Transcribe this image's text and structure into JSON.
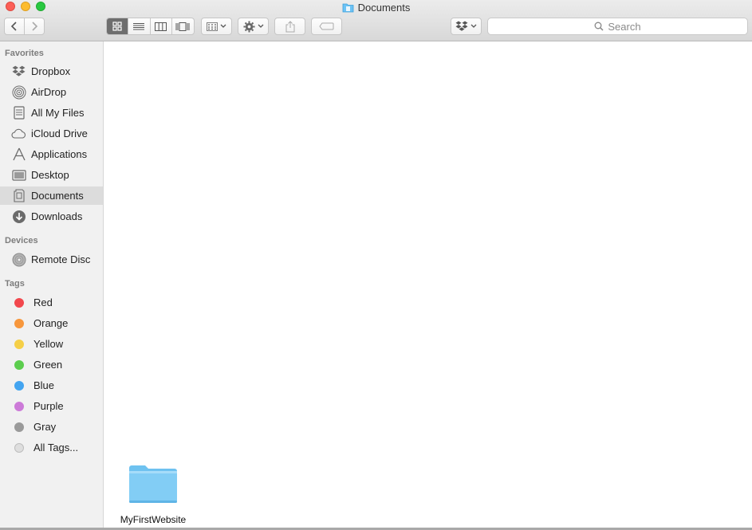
{
  "window": {
    "title": "Documents"
  },
  "toolbar": {
    "back": "chevron-left-icon",
    "forward": "chevron-right-icon",
    "views": [
      "icon-view",
      "list-view",
      "column-view",
      "cover-flow-view"
    ],
    "active_view": "icon-view",
    "search_placeholder": "Search"
  },
  "sidebar": {
    "favorites_label": "Favorites",
    "favorites": [
      {
        "label": "Dropbox",
        "icon": "dropbox-icon"
      },
      {
        "label": "AirDrop",
        "icon": "airdrop-icon"
      },
      {
        "label": "All My Files",
        "icon": "all-files-icon"
      },
      {
        "label": "iCloud Drive",
        "icon": "cloud-icon"
      },
      {
        "label": "Applications",
        "icon": "applications-icon"
      },
      {
        "label": "Desktop",
        "icon": "desktop-icon"
      },
      {
        "label": "Documents",
        "icon": "documents-icon",
        "selected": true
      },
      {
        "label": "Downloads",
        "icon": "downloads-icon"
      }
    ],
    "devices_label": "Devices",
    "devices": [
      {
        "label": "Remote Disc",
        "icon": "disc-icon"
      }
    ],
    "tags_label": "Tags",
    "tags": [
      {
        "label": "Red",
        "color": "#f2484d"
      },
      {
        "label": "Orange",
        "color": "#f7973c"
      },
      {
        "label": "Yellow",
        "color": "#f5cf47"
      },
      {
        "label": "Green",
        "color": "#5ccd4e"
      },
      {
        "label": "Blue",
        "color": "#43a4f0"
      },
      {
        "label": "Purple",
        "color": "#cc7ad8"
      },
      {
        "label": "Gray",
        "color": "#9a9a9a"
      },
      {
        "label": "All Tags...",
        "color": "#dedede"
      }
    ]
  },
  "content": {
    "items": [
      {
        "name": "MyFirstWebsite",
        "kind": "folder"
      }
    ]
  }
}
